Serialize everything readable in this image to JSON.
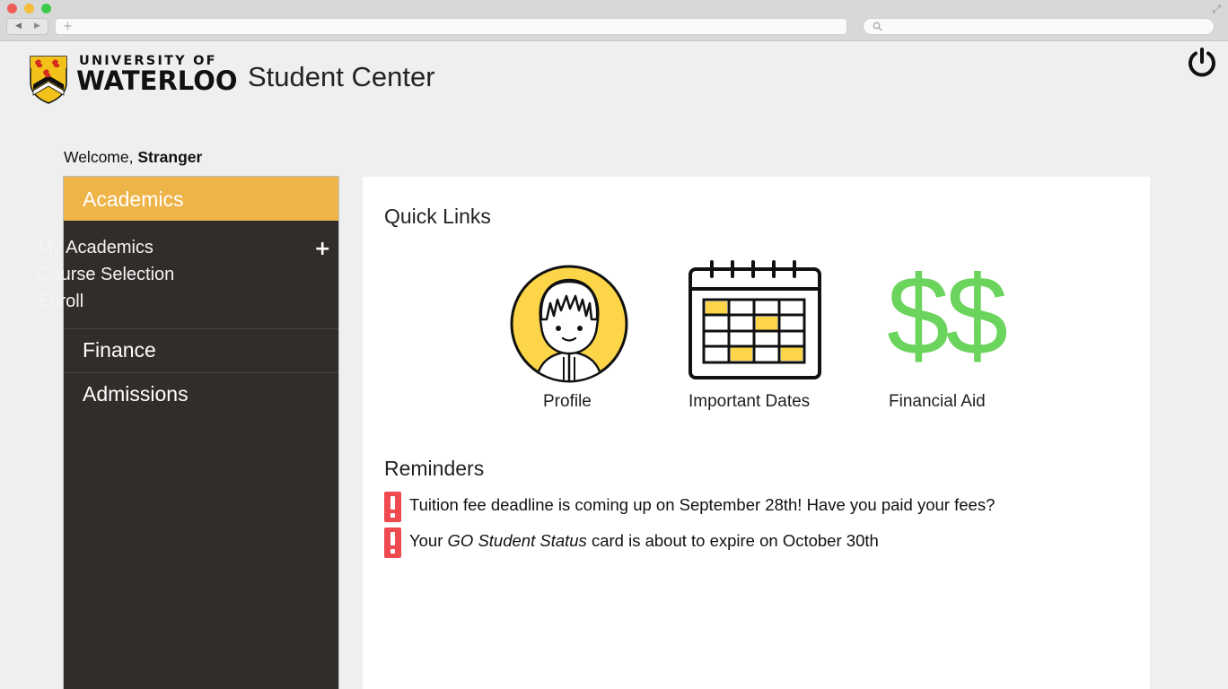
{
  "browser": {
    "nav_back": "◀",
    "nav_forward": "▶",
    "url_plus": "+",
    "expand_icon": "⤢"
  },
  "header": {
    "logo_line1": "UNIVERSITY OF",
    "logo_line2": "WATERLOO",
    "title": "Student Center",
    "power_icon": "power-icon"
  },
  "welcome": {
    "prefix": "Welcome, ",
    "name": "Stranger"
  },
  "sidebar": {
    "active_section": "Academics",
    "academics_items": [
      {
        "label": "My Academics"
      },
      {
        "label": "Course Selection"
      },
      {
        "label": "Enroll"
      }
    ],
    "expand_symbol": "+",
    "sections": [
      {
        "label": "Finance"
      },
      {
        "label": "Admissions"
      }
    ],
    "colors": {
      "active": "#eeb448",
      "background": "#322d2b"
    }
  },
  "quick_links": {
    "title": "Quick Links",
    "items": [
      {
        "label": "Profile",
        "icon": "profile-avatar-icon"
      },
      {
        "label": "Important Dates",
        "icon": "calendar-icon"
      },
      {
        "label": "Financial Aid",
        "icon": "dollar-icon",
        "glyph": "$$"
      }
    ],
    "colors": {
      "profile": "#fcd648",
      "calendar_highlight": "#fcd648",
      "dollar": "#6bd45c"
    }
  },
  "reminders": {
    "title": "Reminders",
    "items": [
      {
        "text": "Tuition fee deadline is coming up on September 28th! Have you paid your fees?"
      },
      {
        "before": "Your ",
        "emphasis": "GO Student Status",
        "after": " card is about to expire on October 30th"
      }
    ],
    "alert_color": "#ee4a50"
  }
}
